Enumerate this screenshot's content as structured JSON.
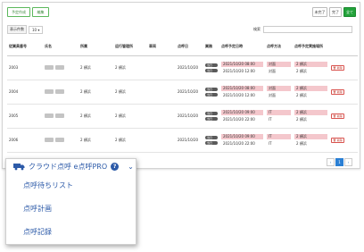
{
  "toolbar": {
    "create_label": "予定作成",
    "edit_label": "編集",
    "filter_labels": [
      "未完了",
      "完了",
      "全て"
    ]
  },
  "table_controls": {
    "length_label": "表示件数",
    "length_value": "10",
    "search_label": "検索"
  },
  "table": {
    "headers": [
      "従業員番号",
      "氏名",
      "所属",
      "运行管理所",
      "車両",
      "点呼日",
      "業務",
      "点呼予定日時",
      "点呼方法",
      "点呼予定実施場所"
    ],
    "delete_label": "削除",
    "rows": [
      {
        "id": "2003",
        "affiliation": "2 横浜",
        "office": "2 横浜",
        "date": "2021/10/20",
        "badge": "当日",
        "slots": [
          {
            "time": "2021/10/20 08:00",
            "method": "対面",
            "place": "2 横浜",
            "hl": true
          },
          {
            "time": "2021/10/20 12:00",
            "method": "対面",
            "place": "2 横浜",
            "hl": false
          }
        ]
      },
      {
        "id": "2004",
        "affiliation": "2 横浜",
        "office": "2 横浜",
        "date": "2021/10/20",
        "badge": "当日",
        "slots": [
          {
            "time": "2021/10/20 08:00",
            "method": "対面",
            "place": "2 横浜",
            "hl": true
          },
          {
            "time": "2021/10/20 12:00",
            "method": "対面",
            "place": "2 横浜",
            "hl": false
          }
        ]
      },
      {
        "id": "2005",
        "affiliation": "2 横浜",
        "office": "2 横浜",
        "date": "2021/10/20",
        "badge": "当日",
        "slots": [
          {
            "time": "2021/10/20 09:00",
            "method": "IT",
            "place": "2 横浜",
            "hl": true
          },
          {
            "time": "2021/10/20 22:00",
            "method": "IT",
            "place": "2 横浜",
            "hl": false
          }
        ]
      },
      {
        "id": "2006",
        "affiliation": "2 横浜",
        "office": "2 横浜",
        "date": "2021/10/20",
        "badge": "当日",
        "slots": [
          {
            "time": "2021/10/20 09:00",
            "method": "IT",
            "place": "2 横浜",
            "hl": true
          },
          {
            "time": "2021/10/20 22:00",
            "method": "IT",
            "place": "2 横浜",
            "hl": false
          }
        ]
      }
    ]
  },
  "pagination": {
    "prev": "‹",
    "current": "1",
    "next": "›"
  },
  "menu": {
    "title": "クラウド点呼 e点呼PRO",
    "help_glyph": "?",
    "chevron_glyph": "⌄",
    "items": [
      "点呼待ちリスト",
      "点呼計画",
      "点呼記録"
    ]
  },
  "colors": {
    "menu_text": "#2c5aa8",
    "highlight": "#f4c7cc",
    "primary": "#2a7fd4",
    "badge": "#5a5a5a"
  }
}
